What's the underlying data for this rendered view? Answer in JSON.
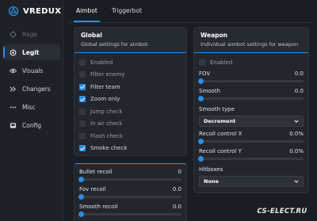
{
  "brand": {
    "name": "VREDUX"
  },
  "sidebar": {
    "items": [
      {
        "label": "Rage",
        "icon": "crosshair-icon",
        "state": "disabled"
      },
      {
        "label": "Legit",
        "icon": "target-icon",
        "state": "active"
      },
      {
        "label": "Visuals",
        "icon": "eye-icon",
        "state": "normal"
      },
      {
        "label": "Changers",
        "icon": "chevrons-icon",
        "state": "normal"
      },
      {
        "label": "Misc",
        "icon": "dots-icon",
        "state": "normal"
      },
      {
        "label": "Config",
        "icon": "folder-icon",
        "state": "normal"
      }
    ]
  },
  "tabs": [
    {
      "label": "Aimbot",
      "active": true
    },
    {
      "label": "Triggerbot",
      "active": false
    }
  ],
  "global": {
    "title": "Global",
    "subtitle": "Global settings for aimbot",
    "checks": [
      {
        "label": "Enabled",
        "checked": false
      },
      {
        "label": "Filter enemy",
        "checked": false
      },
      {
        "label": "Filter team",
        "checked": true
      },
      {
        "label": "Zoom only",
        "checked": true
      },
      {
        "label": "Jump check",
        "checked": false
      },
      {
        "label": "In air check",
        "checked": false
      },
      {
        "label": "Flash check",
        "checked": false
      },
      {
        "label": "Smoke check",
        "checked": true
      }
    ]
  },
  "recoil": {
    "sliders": [
      {
        "label": "Bullet recoil",
        "value": "0"
      },
      {
        "label": "Fov recoil",
        "value": "0.0"
      },
      {
        "label": "Smooth recoil",
        "value": "0.0"
      }
    ]
  },
  "weapon": {
    "title": "Weapon",
    "subtitle": "Individual aimbot settings for weapon",
    "enabled": {
      "label": "Enabled",
      "checked": false
    },
    "fov": {
      "label": "FOV",
      "value": "0.0"
    },
    "smooth": {
      "label": "Smooth",
      "value": "0.0"
    },
    "smooth_type": {
      "label": "Smooth type",
      "value": "Decrement"
    },
    "rcs_x": {
      "label": "Recoil control X",
      "value": "0.0%"
    },
    "rcs_y": {
      "label": "Recoil control Y",
      "value": "0.0%"
    },
    "hitboxes": {
      "label": "Hitboxes",
      "value": "None"
    }
  },
  "watermark": {
    "text": "CS-ELECT.RU"
  },
  "colors": {
    "accent": "#2b8de6",
    "background": "#1a1d22",
    "panel": "#23272d"
  }
}
